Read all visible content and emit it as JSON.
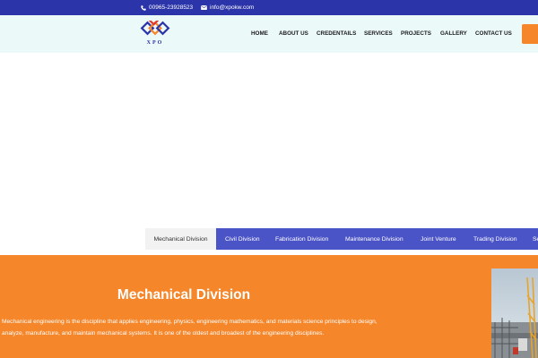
{
  "topbar": {
    "phone": "00965-23928523",
    "email": "info@xpokw.com"
  },
  "logo": {
    "text": "XPO"
  },
  "nav": {
    "items": [
      {
        "label": "HOME"
      },
      {
        "label": "ABOUT US"
      },
      {
        "label": "CREDENTAILS"
      },
      {
        "label": "SERVICES"
      },
      {
        "label": "PROJECTS"
      },
      {
        "label": "GALLERY"
      },
      {
        "label": "CONTACT US"
      }
    ]
  },
  "tabs": {
    "items": [
      {
        "label": "Mechanical Division",
        "active": true
      },
      {
        "label": "Civil Division"
      },
      {
        "label": "Fabrication Division"
      },
      {
        "label": "Maintenance Division"
      },
      {
        "label": "Joint Venture"
      },
      {
        "label": "Trading Division"
      },
      {
        "label": "Se"
      }
    ]
  },
  "section": {
    "title": "Mechanical Division",
    "text": "Mechanical engineering is the discipline that applies engineering, physics, engineering mathematics, and materials science principles to design, analyze, manufacture, and maintain mechanical systems. It is one of the oldest and broadest of the engineering disciplines."
  },
  "colors": {
    "topbar": "#2b34a8",
    "header_bg": "#ecf9f9",
    "tabs_bg": "#4b54c7",
    "accent_orange": "#f5862a"
  }
}
